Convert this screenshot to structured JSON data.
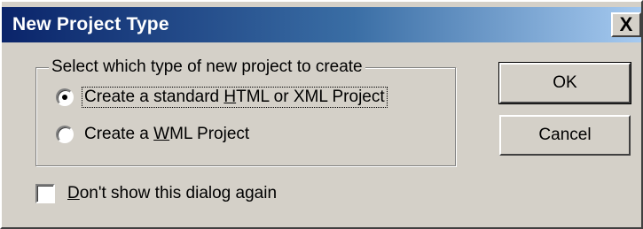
{
  "window": {
    "title": "New Project Type",
    "close_glyph": "X"
  },
  "group": {
    "legend": "Select which type of new project to create",
    "options": [
      {
        "pre": "Create a standard ",
        "accel": "H",
        "post": "TML or XML Project",
        "checked": true
      },
      {
        "pre": "Create a ",
        "accel": "W",
        "post": "ML Project",
        "checked": false
      }
    ]
  },
  "checkbox": {
    "accel": "D",
    "post": "on't show this dialog again",
    "checked": false
  },
  "buttons": {
    "ok": "OK",
    "cancel": "Cancel"
  },
  "icons": [
    "close-icon",
    "radio-selected-icon",
    "radio-unselected-icon",
    "checkbox-unchecked-icon"
  ],
  "colors": {
    "title_gradient_start": "#0a246a",
    "title_gradient_end": "#a6caf0",
    "face": "#d4d0c8"
  }
}
